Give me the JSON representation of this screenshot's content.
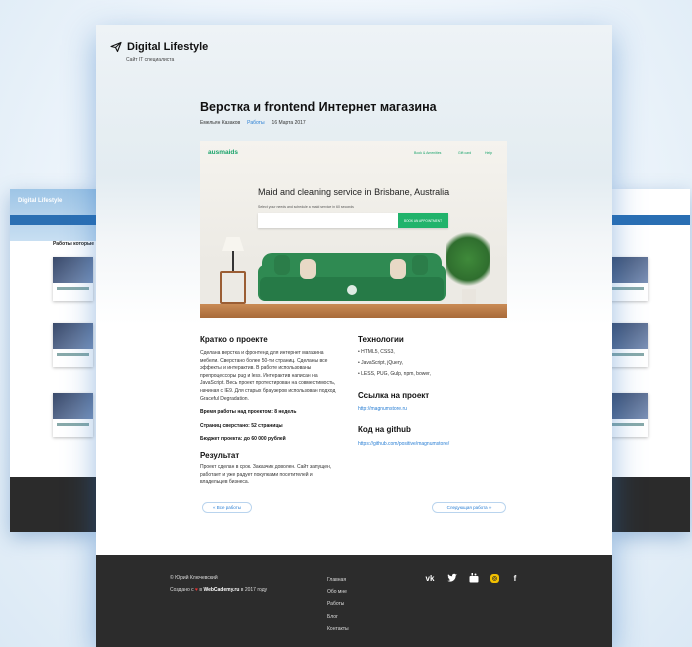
{
  "site": {
    "title": "Digital Lifestyle",
    "subtitle": "Сайт IT специалиста"
  },
  "article": {
    "title": "Верстка и frontend Интернет магазина",
    "author": "Емельян Казаков",
    "category": "Работы",
    "date": "16 Марта 2017"
  },
  "project_shot": {
    "brand": "ausmaids",
    "nav": [
      "Book & Amenities",
      "Gift card",
      "Help"
    ],
    "headline": "Maid and cleaning service in Brisbane, Australia",
    "subline": "Select your needs and schedule a maid service in 60 seconds",
    "cta": "BOOK AN APPOINTMENT"
  },
  "about": {
    "title": "Кратко о проекте",
    "text": "Сделана верстка и фронтенд для интернет магазина мебели. Сверстано более 50-ти страниц. Сделаны все эффекты и интерактив. В работе использованы препроцессоры pug и less. Интерактив написан на JavaScript. Весь проект протестирован на совместимость, начиная с IE9. Для старых браузеров использован подход Graceful Degradation.",
    "time": "Время работы над проектом: 8 недель",
    "pages": "Страниц сверстано: 52 страницы",
    "budget": "Бюджет проекта: до 60 000 рублей"
  },
  "result": {
    "title": "Результат",
    "text": "Проект сделан в срок. Заказчик доволен. Сайт запущен, работает и уже радует покупками посетителей и владельцев бизнеса."
  },
  "tech": {
    "title": "Технологии",
    "items": [
      "• HTML5, CSS3,",
      "• JavaScript, jQuery,",
      "• LESS, PUG, Gulp, npm, bower,"
    ]
  },
  "project_link": {
    "title": "Ссылка на проект",
    "url": "http://magnumstore.ru"
  },
  "github": {
    "title": "Код на github",
    "url": "https://github.com/positive/magnumstore/"
  },
  "pager": {
    "prev": "« Все работы",
    "next": "Следующая работа »"
  },
  "footer": {
    "copyright": "© Юрий Ключевский",
    "made_prefix": "Создано с",
    "made_brand": "WebCademy.ru",
    "made_suffix": "в 2017 году",
    "menu": [
      "Главная",
      "Обо мне",
      "Работы",
      "Блог",
      "Контакты"
    ],
    "socials": [
      "vk-icon",
      "twitter-icon",
      "youtube-icon",
      "instagram-icon",
      "facebook-icon"
    ]
  },
  "side_left": {
    "title": "Digital Lifestyle",
    "section": "Работы которые"
  }
}
